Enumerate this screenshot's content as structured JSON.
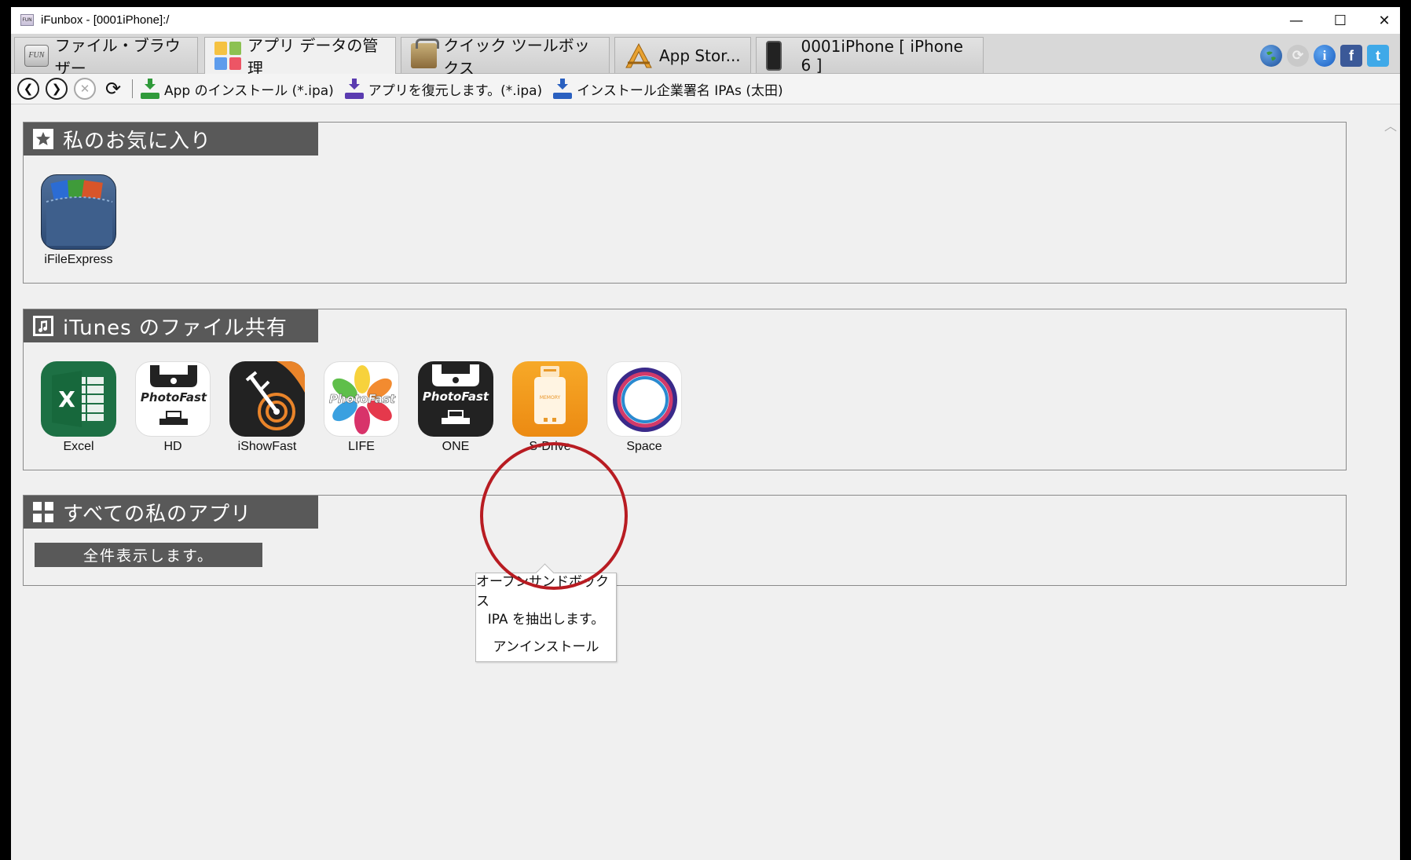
{
  "window": {
    "title": "iFunbox - [0001iPhone]:/",
    "controls": {
      "minimize": "—",
      "maximize": "☐",
      "close": "✕"
    }
  },
  "tabs": [
    {
      "label": "ファイル・ブラウザー",
      "icon": "fun-drive-icon"
    },
    {
      "label": "アプリ データの管理",
      "icon": "app-grid-icon",
      "active": true
    },
    {
      "label": "クイック ツールボックス",
      "icon": "toolbox-icon"
    },
    {
      "label": "App Stor...",
      "icon": "app-store-icon"
    },
    {
      "label": "0001iPhone [ iPhone 6 ]",
      "icon": "iphone-icon"
    }
  ],
  "header_icons": [
    "globe-icon",
    "refresh-icon",
    "info-icon",
    "facebook-icon",
    "twitter-icon"
  ],
  "toolbar": {
    "install_app": "App のインストール (*.ipa)",
    "restore_app": "アプリを復元します。(*.ipa)",
    "install_enterprise": "インストール企業署名 IPAs (太田)"
  },
  "sections": {
    "favorites": {
      "title": "私のお気に入り",
      "apps": [
        {
          "name": "iFileExpress"
        }
      ]
    },
    "itunes_sharing": {
      "title": "iTunes のファイル共有",
      "apps": [
        {
          "name": "Excel"
        },
        {
          "name": "HD",
          "brand": "PhotoFast"
        },
        {
          "name": "iShowFast"
        },
        {
          "name": "LIFE",
          "brand": "PhotoFast"
        },
        {
          "name": "ONE",
          "brand": "PhotoFast"
        },
        {
          "name": "S-Drive",
          "chip_text": "MEMORY"
        },
        {
          "name": "Space"
        }
      ]
    },
    "all_apps": {
      "title": "すべての私のアプリ",
      "show_all": "全件表示します。"
    }
  },
  "context_menu": {
    "items": [
      "オープンサンドボックス",
      "IPA を抽出します。",
      "アンインストール"
    ]
  },
  "colors": {
    "section_header": "#595959",
    "highlight_circle": "#b81c22",
    "excel_green": "#1d7044",
    "sdrive_orange": "#f29a1c"
  }
}
